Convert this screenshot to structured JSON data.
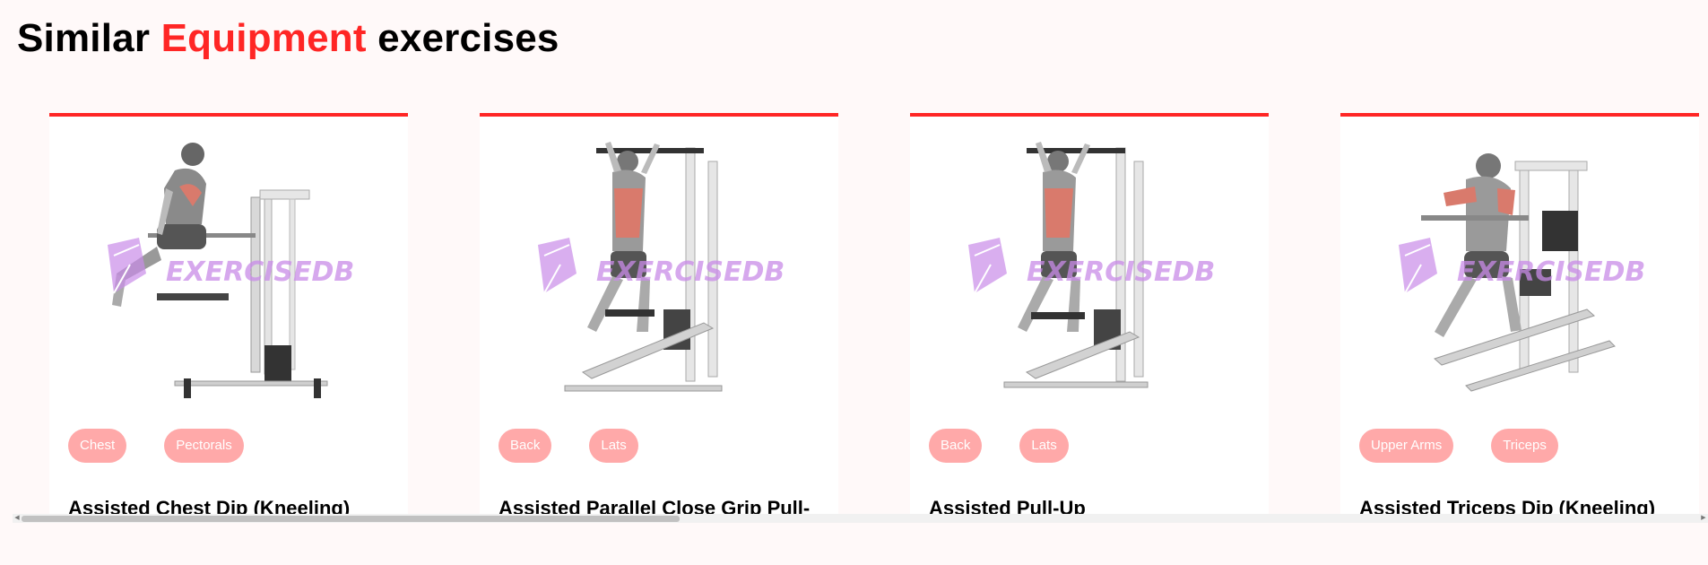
{
  "section": {
    "title_prefix": "Similar ",
    "title_accent": "Equipment",
    "title_suffix": " exercises"
  },
  "colors": {
    "accent": "#ff2625",
    "tag_bg": "#ffa9a9",
    "page_bg": "#fff9f9"
  },
  "watermark": "EXERCISEDB",
  "cards": [
    {
      "name": "Assisted Chest Dip (Kneeling)",
      "tags": [
        "Chest",
        "Pectorals"
      ],
      "image": "chest-dip-machine-illustration"
    },
    {
      "name": "Assisted Parallel Close Grip Pull-",
      "tags": [
        "Back",
        "Lats"
      ],
      "image": "parallel-grip-pull-up-illustration"
    },
    {
      "name": "Assisted Pull-Up",
      "tags": [
        "Back",
        "Lats"
      ],
      "image": "pull-up-machine-illustration"
    },
    {
      "name": "Assisted Triceps Dip (Kneeling)",
      "tags": [
        "Upper Arms",
        "Triceps"
      ],
      "image": "triceps-dip-machine-illustration"
    }
  ]
}
